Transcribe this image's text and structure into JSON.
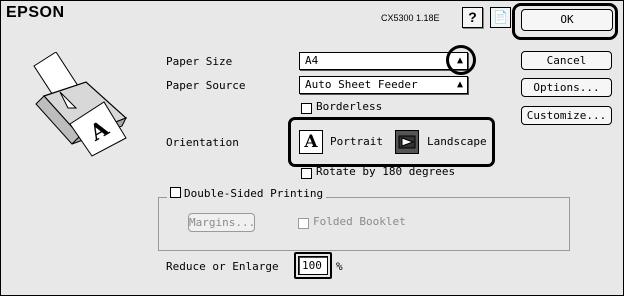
{
  "header": {
    "brand": "EPSON",
    "version": "CX5300 1.18E",
    "help_label": "?"
  },
  "buttons": {
    "ok": "OK",
    "cancel": "Cancel",
    "options": "Options...",
    "customize": "Customize..."
  },
  "paper_size": {
    "label": "Paper Size",
    "value": "A4"
  },
  "paper_source": {
    "label": "Paper Source",
    "value": "Auto Sheet Feeder"
  },
  "borderless": {
    "label": "Borderless",
    "checked": false
  },
  "orientation": {
    "label": "Orientation",
    "portrait": "Portrait",
    "landscape": "Landscape",
    "selected": "Landscape"
  },
  "rotate": {
    "label": "Rotate by 180 degrees",
    "checked": false
  },
  "double_sided": {
    "label": "Double-Sided Printing",
    "checked": false,
    "margins_label": "Margins...",
    "folded_booklet": "Folded Booklet"
  },
  "reduce": {
    "label": "Reduce or Enlarge",
    "value": "100",
    "unit": "%"
  }
}
